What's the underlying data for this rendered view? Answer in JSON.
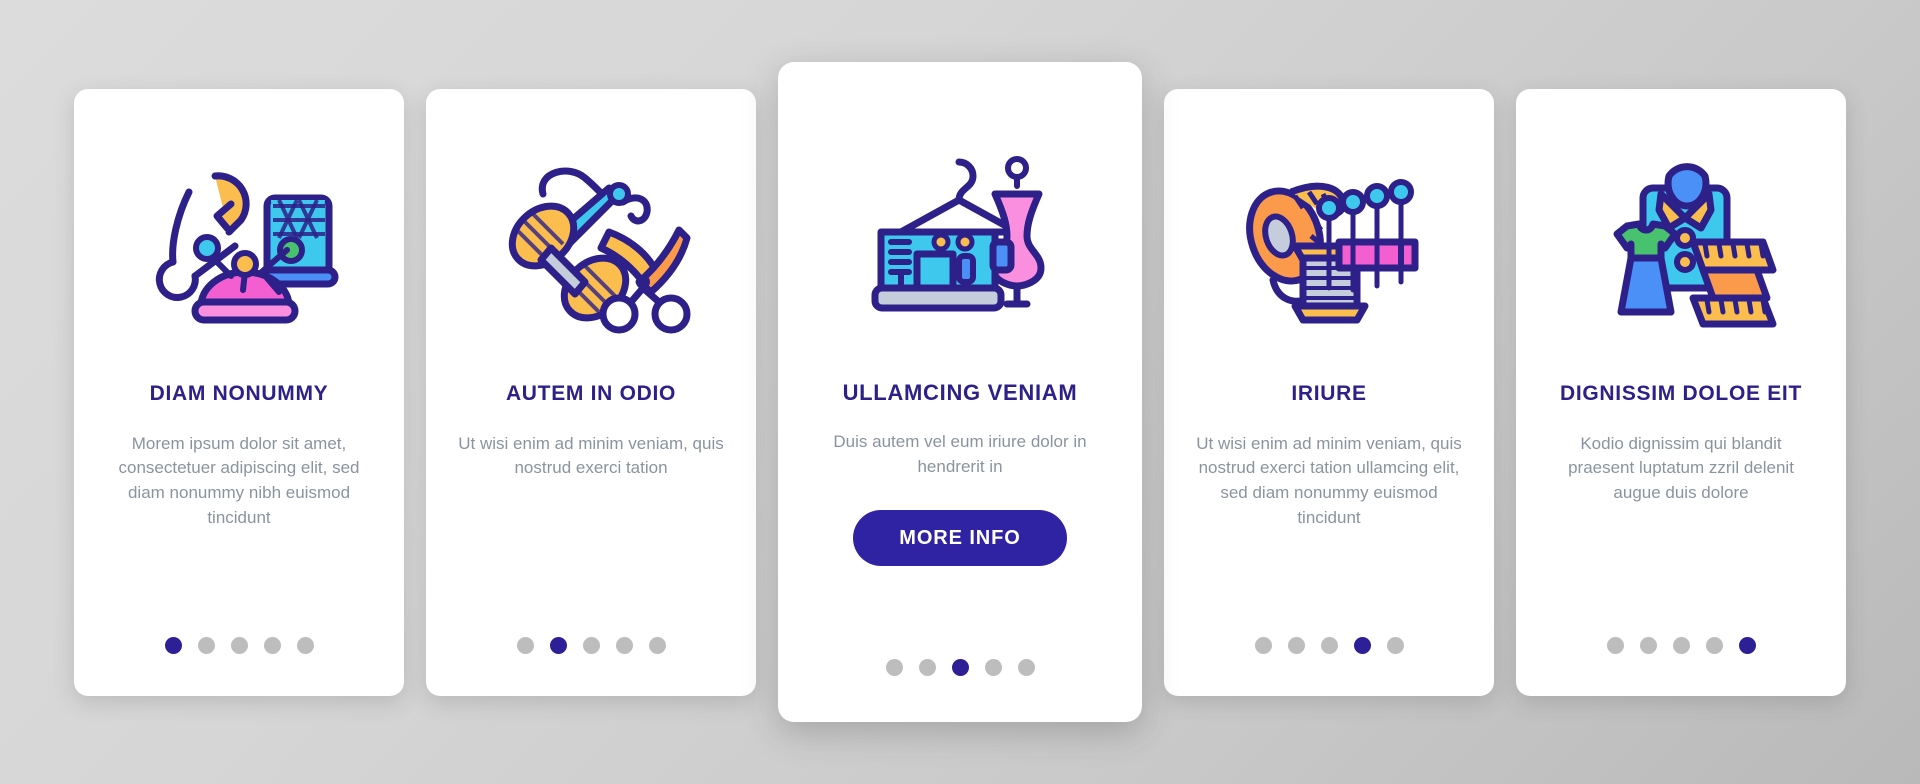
{
  "theme": {
    "background_start": "#dcdcdc",
    "background_end": "#b9b9b9",
    "card_background": "#ffffff",
    "title_color": "#2d2189",
    "body_color": "#8a949e",
    "accent_color": "#3023a3",
    "dot_inactive_color": "#bdbdbd",
    "dot_active_color": "#2d1f95"
  },
  "cards": [
    {
      "id": "card-diam-nonummy",
      "icon": "sewing-pins-thimble-icon",
      "title": "DIAM NONUMMY",
      "body": "Morem ipsum dolor sit amet, consectetuer adipiscing elit, sed diam nonummy nibh euismod tincidunt",
      "dots": 5,
      "active_dot": 1,
      "featured": false,
      "button": null
    },
    {
      "id": "card-autem-in-odio",
      "icon": "needle-thread-scissors-icon",
      "title": "AUTEM IN ODIO",
      "body": "Ut wisi enim ad minim veniam, quis nostrud exerci tation",
      "dots": 5,
      "active_dot": 2,
      "featured": false,
      "button": null
    },
    {
      "id": "card-ullamcing-veniam",
      "icon": "sewing-machine-mannequin-icon",
      "title": "ULLAMCING VENIAM",
      "body": "Duis autem vel eum iriure dolor in hendrerit in",
      "dots": 5,
      "active_dot": 3,
      "featured": true,
      "button": "MORE INFO"
    },
    {
      "id": "card-iriure",
      "icon": "measuring-tape-spool-pins-icon",
      "title": "IRIURE",
      "body": "Ut wisi enim ad minim veniam, quis nostrud exerci tation ullamcing elit, sed diam nonummy euismod tincidunt",
      "dots": 5,
      "active_dot": 4,
      "featured": false,
      "button": null
    },
    {
      "id": "card-dignissim-doloe-eit",
      "icon": "clothes-measuring-tape-icon",
      "title": "DIGNISSIM DOLOE EIT",
      "body": "Kodio dignissim qui blandit praesent luptatum zzril delenit augue duis dolore",
      "dots": 5,
      "active_dot": 5,
      "featured": false,
      "button": null
    }
  ]
}
